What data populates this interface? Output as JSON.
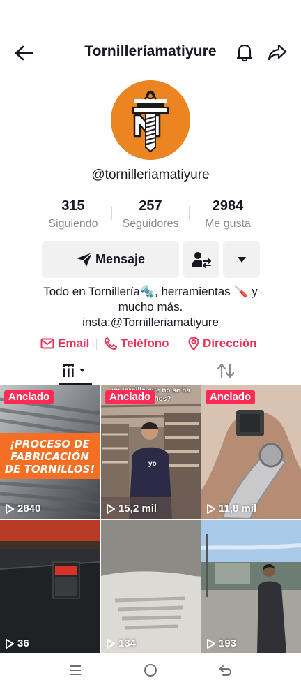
{
  "header": {
    "title": "Tornilleríamatiyure",
    "back_icon": "arrow-left-icon",
    "bell_icon": "bell-icon",
    "share_icon": "share-icon"
  },
  "profile": {
    "avatar_icon": "tm-logo",
    "username": "@tornilleriamatiyure",
    "stats": [
      {
        "value": "315",
        "label": "Siguiendo"
      },
      {
        "value": "257",
        "label": "Seguidores"
      },
      {
        "value": "2984",
        "label": "Me gusta"
      }
    ]
  },
  "actions": {
    "message_label": "Mensaje",
    "message_icon": "send-icon",
    "friend_icon": "swap-user-icon",
    "more_icon": "caret-down-icon"
  },
  "bio": {
    "line1": "Todo en Tornillería🔩, herramientas 🪛 y",
    "line2": "mucho más.",
    "line3": "insta:@Tornilleriamatiyure"
  },
  "contacts": [
    {
      "label": "Email",
      "icon": "mail-icon"
    },
    {
      "label": "Teléfono",
      "icon": "phone-icon"
    },
    {
      "label": "Dirección",
      "icon": "location-pin-icon"
    }
  ],
  "tabs": {
    "videos_icon": "grid-icon",
    "reposts_icon": "repost-icon"
  },
  "videos": [
    {
      "pinned": "Anclado",
      "views": "2840",
      "overlay_text": [
        "¡PROCESO DE",
        "FABRICACIÓN",
        "DE TORNILLOS!"
      ]
    },
    {
      "pinned": "Anclado",
      "views": "15,2 mil",
      "overlay_text": [
        "un tornillo que no se ha",
        "de 20 años?"
      ],
      "sticker": "yo"
    },
    {
      "pinned": "Anclado",
      "views": "11,8 mil"
    },
    {
      "views": "36"
    },
    {
      "views": "134"
    },
    {
      "views": "193"
    }
  ],
  "colors": {
    "accent": "#fe2c55",
    "contact": "#e8345a",
    "avatar_bg": "#ec8421",
    "muted": "#8a8b91"
  },
  "navbar": {
    "recent_icon": "recent-apps-icon",
    "home_icon": "home-circle-icon",
    "back_icon": "system-back-icon"
  }
}
